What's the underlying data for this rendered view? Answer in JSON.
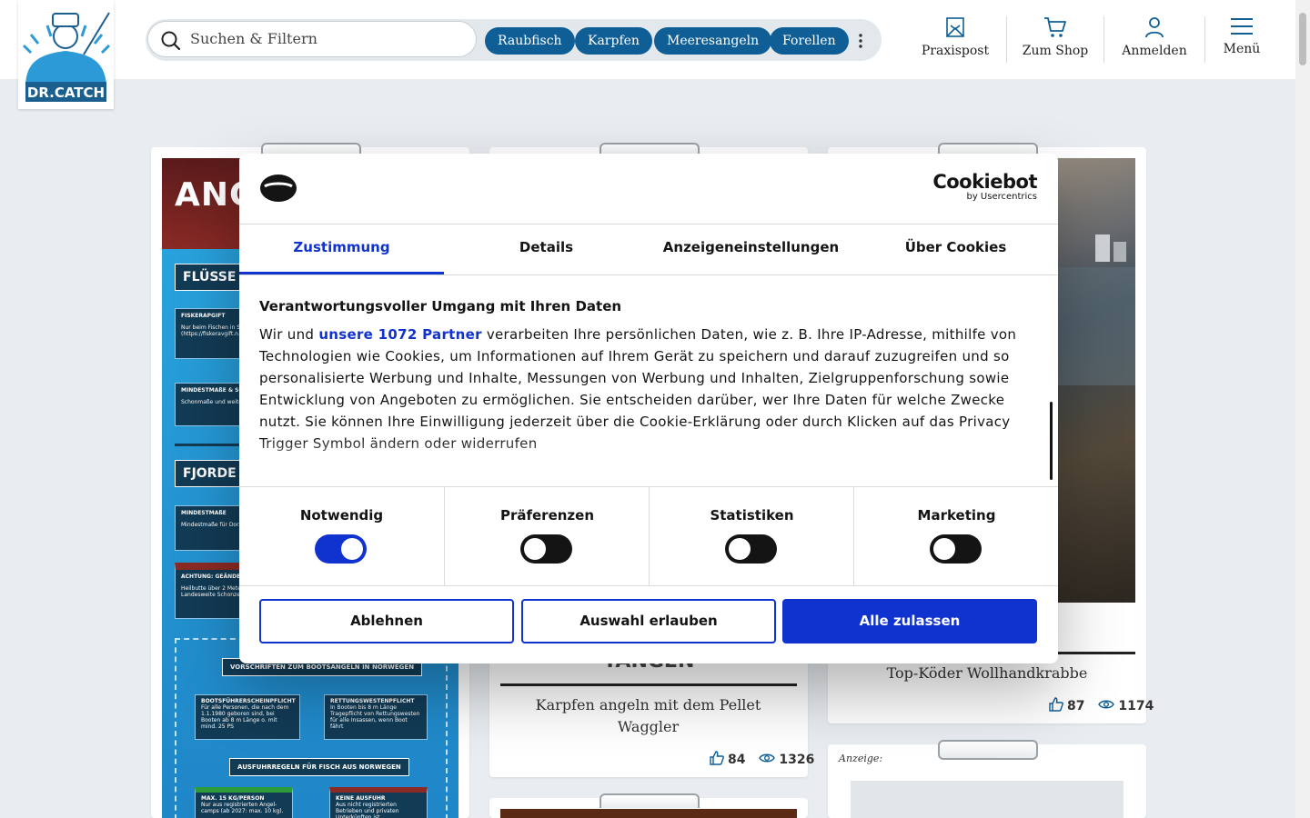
{
  "header": {
    "logo_text": "DR.CATCH",
    "search_placeholder": "Suchen & Filtern",
    "tags": [
      "Raubfisch",
      "Karpfen",
      "Meeresangeln",
      "Forellen"
    ],
    "nav": {
      "praxispost": "Praxispost",
      "shop": "Zum Shop",
      "login": "Anmelden",
      "menu": "Menü"
    }
  },
  "cards": {
    "infographic": {
      "title": "ANGEL",
      "band1": "FLÜSSE & S",
      "box1_head": "FISKERAPGIFT",
      "box1_text": "Nur beim Fischen in S... von Lachs, Meerforell... zusätzlich staatliche ... (https://fiskeravgift.n...",
      "box2_head": "MINDESTMAßE & SC...",
      "box2_text": "Schonmaße und weite... schriften für Süßwass... lichen Bestimmungen...",
      "band2": "FJORDE & M",
      "box3_head": "MINDESTMAßE",
      "box3_text": "Mindestmaße für Dors... Heilbutt, Schellfisch, l... beachten!",
      "box4_head": "ACHTUNG: GEÄNDERT",
      "box4_text": "Heilbutte über 2 Meter... zurückgesetzt werden... Mindestmaß: 84 cm. Landesweite Schonzei... 20. Dez.–20. April",
      "panel_head": "VORSCHRIFTEN ZUM BOOTSANGELN IN NORWEGEN",
      "mini1_head": "BOOTSFÜHRERSCHEINPFLICHT",
      "mini1_text": "Für alle Personen, die nach dem 1.1.1980 geboren sind, bei Booten ab 8 m Länge o. mit mind. 25 PS",
      "mini2_head": "RETTUNGSWESTENPFLICHT",
      "mini2_text": "In Booten bis 8 m Länge Tragepflicht von Rettungswesten für alle Insassen, wenn Boot fährt",
      "panel2_head": "AUSFUHRREGELN FÜR FISCH AUS NORWEGEN",
      "mini3_head": "MAX. 15 KG/PERSON",
      "mini3_text": "Nur aus registrierten Angel-camps (ab 2027: max. 10 kg).",
      "mini4_head": "KEINE AUSFUHR",
      "mini4_text": "Aus nicht registrierten Betrieben und privaten Unterkünften ist"
    },
    "middle": {
      "partial_heading": "YANGEN",
      "title": "Karpfen angeln mit dem Pellet Waggler",
      "likes": "84",
      "views": "1326"
    },
    "right": {
      "title": "Top-Köder Wollhandkrabbe",
      "likes": "87",
      "views": "1174",
      "ad_label": "Anzeige:"
    }
  },
  "cookie": {
    "brand": "Cookiebot",
    "brand_sub": "by Usercentrics",
    "tabs": [
      "Zustimmung",
      "Details",
      "Anzeigeneinstellungen",
      "Über Cookies"
    ],
    "heading": "Verantwortungsvoller Umgang mit Ihren Daten",
    "text_before_link": "Wir und ",
    "link": "unsere 1072 Partner",
    "text_after_link": " verarbeiten Ihre persönlichen Daten, wie z. B. Ihre IP-Adresse, mithilfe von Technologien wie Cookies, um Informationen auf Ihrem Gerät zu speichern und darauf zuzugreifen und so personalisierte Werbung und Inhalte, Messungen von Werbung und Inhalten, Zielgruppenforschung sowie Entwicklung von Angeboten zu ermöglichen. Sie entscheiden darüber, wer Ihre Daten für welche Zwecke nutzt. Sie können Ihre Einwilligung jederzeit über die Cookie-Erklärung oder durch Klicken auf das Privacy Trigger Symbol ändern oder widerrufen",
    "categories": [
      {
        "label": "Notwendig",
        "on": true
      },
      {
        "label": "Präferenzen",
        "on": false
      },
      {
        "label": "Statistiken",
        "on": false
      },
      {
        "label": "Marketing",
        "on": false
      }
    ],
    "buttons": {
      "reject": "Ablehnen",
      "allow_selection": "Auswahl erlauben",
      "allow_all": "Alle zulassen"
    }
  },
  "colors": {
    "accent_blue": "#1032cf",
    "tag_blue": "#0f5f96"
  }
}
